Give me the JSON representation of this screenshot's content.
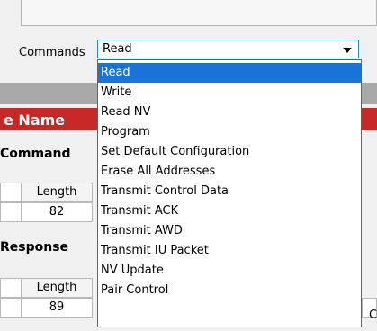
{
  "commands": {
    "label": "Commands",
    "selected": "Read",
    "options": [
      "Read",
      "Write",
      "Read NV",
      "Program",
      "Set Default Configuration",
      "Erase All Addresses",
      "Transmit Control Data",
      "Transmit ACK",
      "Transmit AWD",
      "Transmit IU Packet",
      "NV Update",
      "Pair Control"
    ]
  },
  "background": {
    "name_header": "e Name",
    "command_section": {
      "title": "Command",
      "length_header": "Length",
      "length_value": "82"
    },
    "response_section": {
      "title": "Response",
      "length_header": "Length",
      "length_value": "89",
      "cut_text": "C"
    }
  },
  "colors": {
    "selection": "#1a73d6",
    "name_band": "#c62828",
    "combo_border": "#2a84d2"
  }
}
